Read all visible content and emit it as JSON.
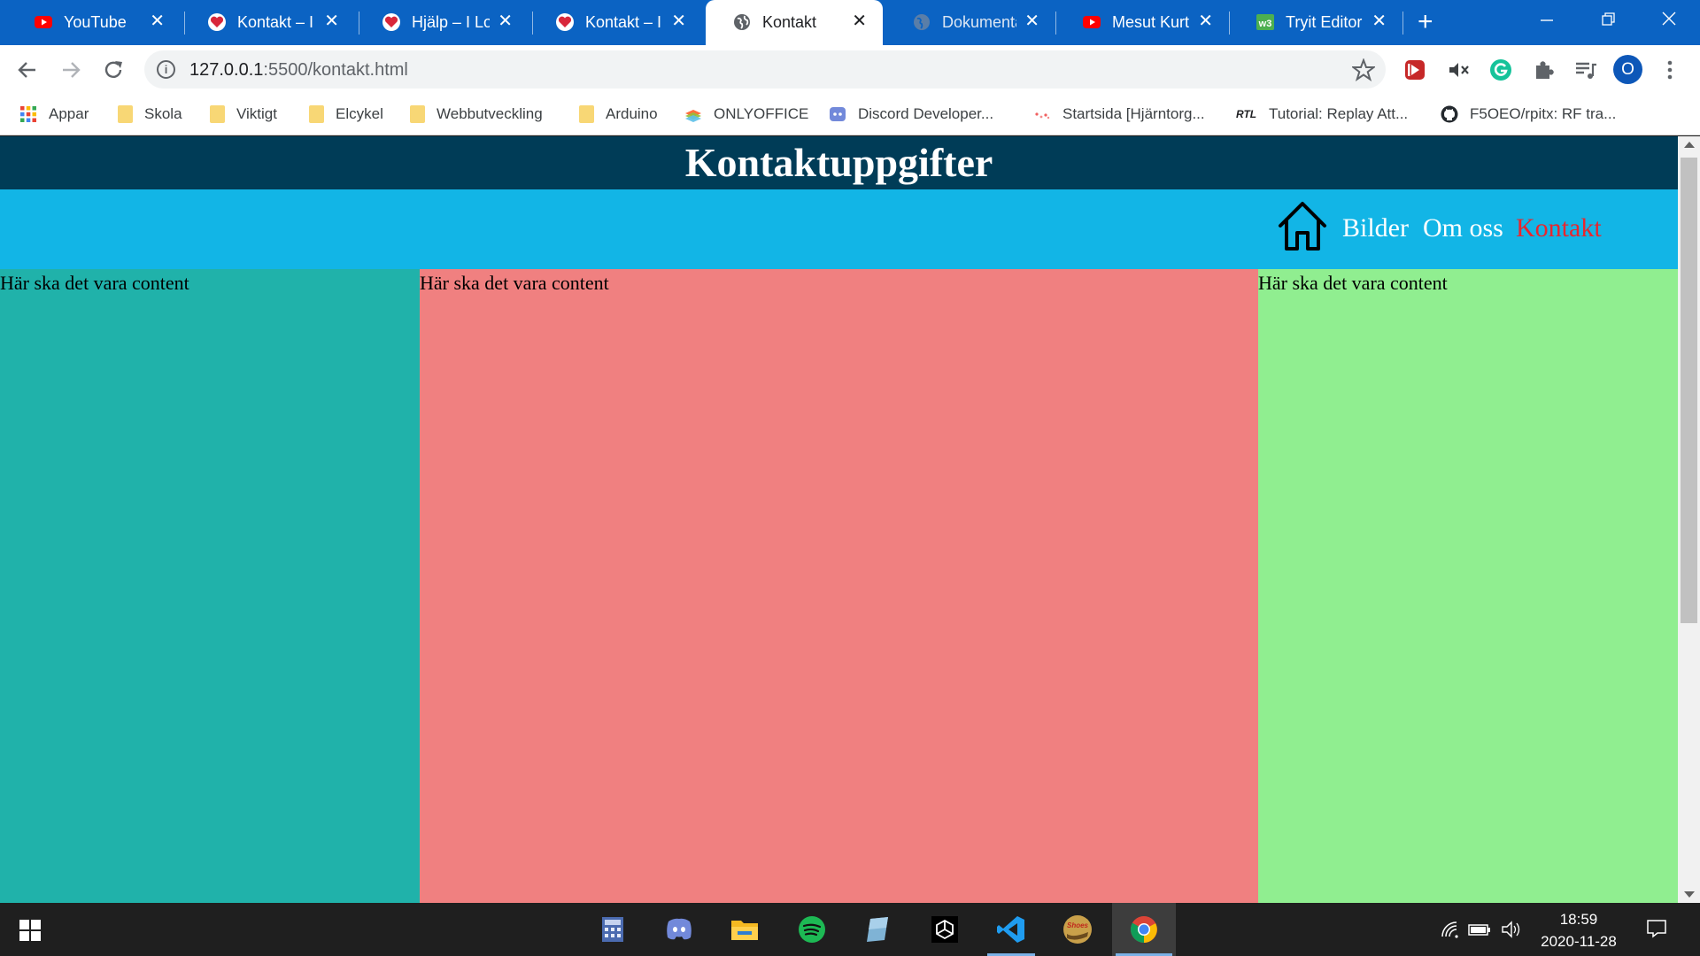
{
  "browser": {
    "tabs": [
      {
        "title": "YouTube",
        "icon": "youtube-icon",
        "active": false
      },
      {
        "title": "Kontakt – I Love",
        "icon": "heart-icon",
        "active": false
      },
      {
        "title": "Hjälp – I Love",
        "icon": "heart-icon",
        "active": false
      },
      {
        "title": "Kontakt – I Love",
        "icon": "heart-icon",
        "active": false
      },
      {
        "title": "Kontakt",
        "icon": "globe-icon",
        "active": true
      },
      {
        "title": "Dokumentation",
        "icon": "globe-icon",
        "active": false
      },
      {
        "title": "Mesut Kurtis",
        "icon": "youtube-icon",
        "active": false
      },
      {
        "title": "Tryit Editor v",
        "icon": "w3schools-icon",
        "active": false
      }
    ],
    "new_tab_label": "+",
    "close_glyph": "✕",
    "url_host": "127.0.0.1",
    "url_rest": ":5500/kontakt.html",
    "profile_initial": "O",
    "bookmarks": [
      {
        "label": "Appar",
        "icon": "apps-grid-icon"
      },
      {
        "label": "Skola",
        "icon": "folder-icon"
      },
      {
        "label": "Viktigt",
        "icon": "folder-icon"
      },
      {
        "label": "Elcykel",
        "icon": "folder-icon"
      },
      {
        "label": "Webbutveckling",
        "icon": "folder-icon"
      },
      {
        "label": "Arduino",
        "icon": "folder-icon"
      },
      {
        "label": "ONLYOFFICE",
        "icon": "onlyoffice-icon"
      },
      {
        "label": "Discord Developer...",
        "icon": "discord-icon"
      },
      {
        "label": "Startsida [Hjärntorg...",
        "icon": "dots-icon"
      },
      {
        "label": "Tutorial: Replay Att...",
        "icon": "rtl-icon"
      },
      {
        "label": "F5OEO/rpitx: RF tra...",
        "icon": "github-icon"
      }
    ]
  },
  "page": {
    "title": "Kontaktuppgifter",
    "nav": [
      {
        "label": "Bilder",
        "current": false
      },
      {
        "label": "Om oss",
        "current": false
      },
      {
        "label": "Kontakt",
        "current": true
      }
    ],
    "columns": [
      {
        "text": "Här ska det vara content",
        "color": "#20b2aa"
      },
      {
        "text": "Här ska det vara content",
        "color": "#f08080"
      },
      {
        "text": "Här ska det vara content",
        "color": "#90ee90"
      }
    ],
    "colors": {
      "header": "#003c57",
      "nav": "#12b5e6",
      "current_link": "#e8262e"
    }
  },
  "taskbar": {
    "apps": [
      "calculator-icon",
      "discord-icon",
      "file-explorer-icon",
      "spotify-icon",
      "notepad-icon",
      "unity-icon",
      "vscode-icon",
      "shoes-app-icon",
      "chrome-icon"
    ],
    "time": "18:59",
    "date": "2020-11-28"
  }
}
